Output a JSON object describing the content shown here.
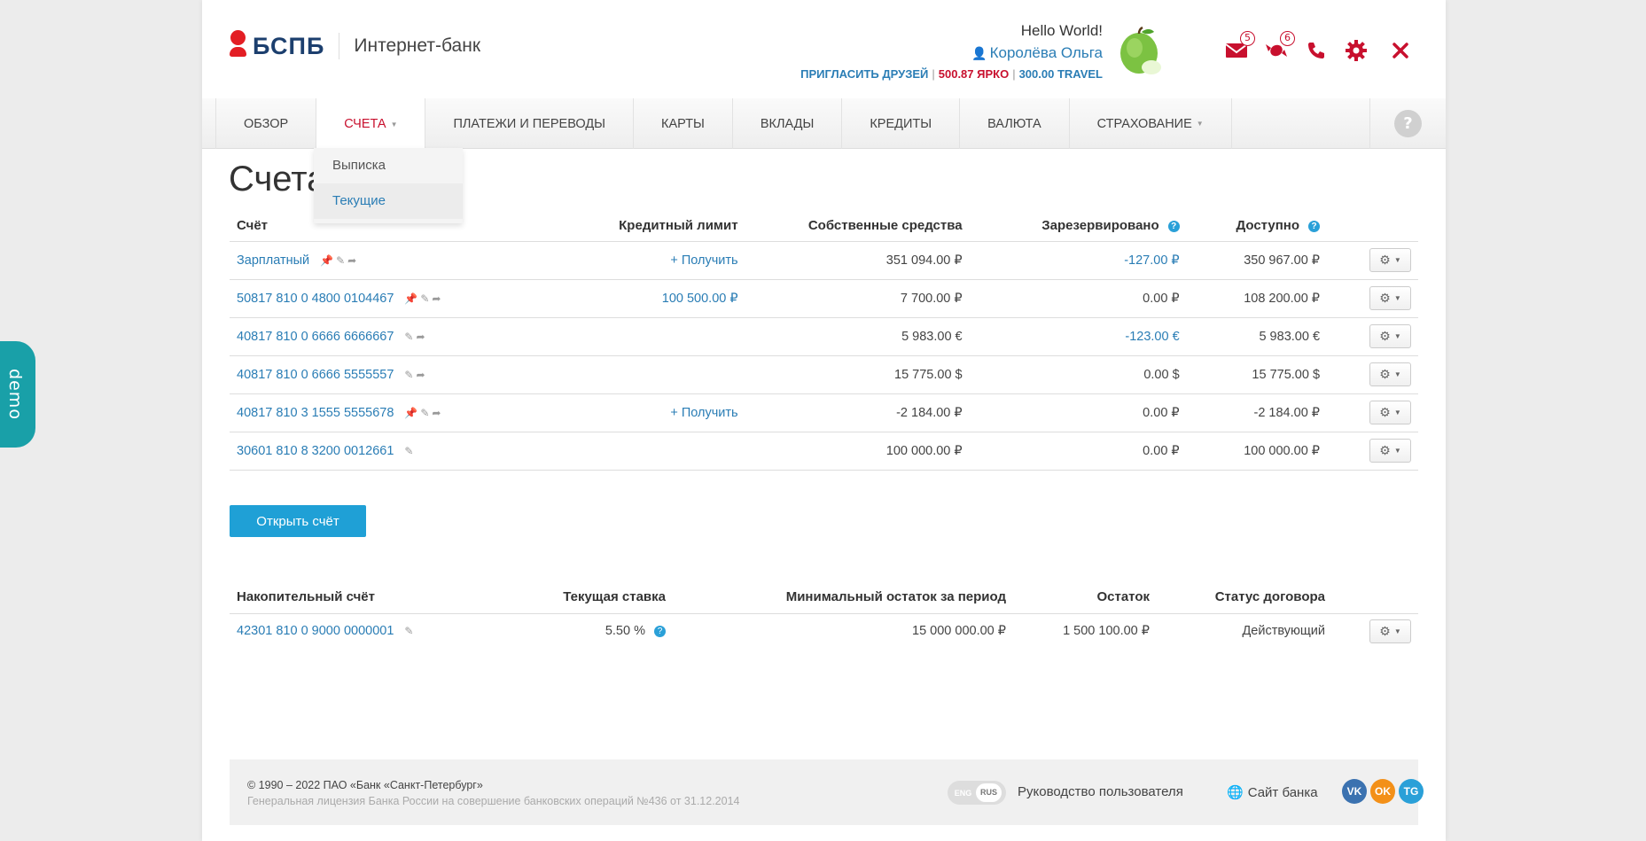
{
  "demo_tab": {
    "label": "demo"
  },
  "header": {
    "logo_text": "БСПБ",
    "app_name": "Интернет-банк",
    "greeting": "Hello World!",
    "username": "Королёва Ольга",
    "invite_label": "ПРИГЛАСИТЬ ДРУЗЕЙ",
    "yarko_label": "500.87 ЯРКО",
    "travel_label": "300.00 TRAVEL",
    "messages_count": "5",
    "gifts_count": "6"
  },
  "nav": {
    "items": [
      {
        "label": "Обзор"
      },
      {
        "label": "Счета"
      },
      {
        "label": "Платежи и переводы"
      },
      {
        "label": "Карты"
      },
      {
        "label": "Вклады"
      },
      {
        "label": "Кредиты"
      },
      {
        "label": "Валюта"
      },
      {
        "label": "Страхование"
      }
    ],
    "help": "?"
  },
  "dropdown": {
    "items": [
      {
        "label": "Выписка"
      },
      {
        "label": "Текущие"
      }
    ]
  },
  "page_title": "Счета",
  "accounts": {
    "headers": {
      "account": "Счёт",
      "credit_limit": "Кредитный лимит",
      "own_funds": "Собственные средства",
      "reserved": "Зарезервировано",
      "available": "Доступно"
    },
    "rows": [
      {
        "name": "Зарплатный",
        "limit": "+ Получить",
        "own": "351 094.00 ₽",
        "reserved": "-127.00 ₽",
        "available": "350 967.00 ₽"
      },
      {
        "name": "50817 810 0 4800 0104467",
        "limit": "100 500.00 ₽",
        "own": "7 700.00 ₽",
        "reserved": "0.00 ₽",
        "available": "108 200.00 ₽"
      },
      {
        "name": "40817 810 0 6666 6666667",
        "limit": "",
        "own": "5 983.00 €",
        "reserved": "-123.00 €",
        "available": "5 983.00 €"
      },
      {
        "name": "40817 810 0 6666 5555557",
        "limit": "",
        "own": "15 775.00 $",
        "reserved": "0.00 $",
        "available": "15 775.00 $"
      },
      {
        "name": "40817 810 3 1555 5555678",
        "limit": "+ Получить",
        "own": "-2 184.00 ₽",
        "reserved": "0.00 ₽",
        "available": "-2 184.00 ₽"
      },
      {
        "name": "30601 810 8 3200 0012661",
        "limit": "",
        "own": "100 000.00 ₽",
        "reserved": "0.00 ₽",
        "available": "100 000.00 ₽"
      }
    ]
  },
  "open_account_button": "Открыть счёт",
  "savings": {
    "headers": {
      "account": "Накопительный счёт",
      "rate": "Текущая ставка",
      "min_balance": "Минимальный остаток за период",
      "balance": "Остаток",
      "status": "Статус договора"
    },
    "row": {
      "name": "42301 810 0 9000 0000001",
      "rate": "5.50 %",
      "min_balance": "15 000 000.00 ₽",
      "balance": "1 500 100.00 ₽",
      "status": "Действующий"
    }
  },
  "footer": {
    "copyright": "© 1990 – 2022 ПАО «Банк «Санкт-Петербург»",
    "license": "Генеральная лицензия Банка России на совершение банковских операций №436 от 31.12.2014",
    "lang_eng": "ENG",
    "lang_rus": "RUS",
    "guide": "Руководство пользователя",
    "site": "Сайт банка",
    "social": {
      "vk": "VK",
      "ok": "OK",
      "tg": "TG"
    }
  },
  "colors": {
    "accent_red": "#c8102e",
    "link_blue": "#2a7db5",
    "button_blue": "#1fa0d6",
    "demo_teal": "#19a0a8"
  }
}
